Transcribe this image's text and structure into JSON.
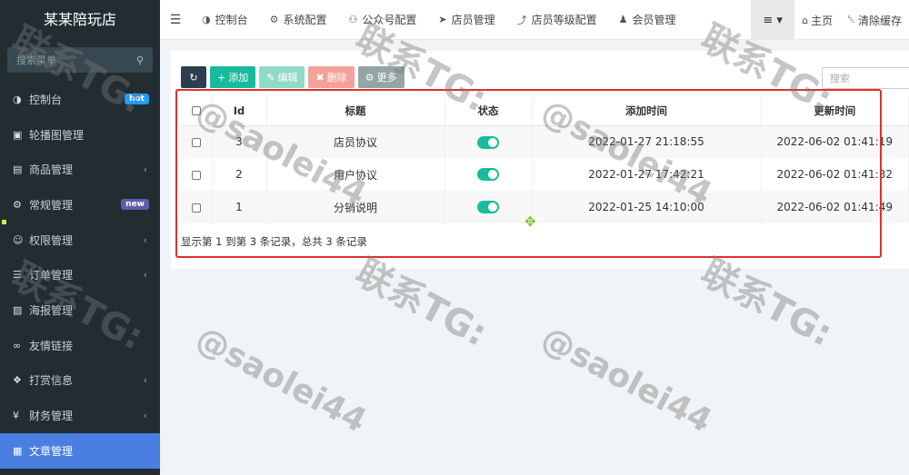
{
  "app": {
    "title": "某某陪玩店"
  },
  "sidebar": {
    "search_placeholder": "搜索菜单",
    "items": [
      {
        "label": "控制台",
        "icon": "dashboard-icon",
        "glyph": "◑",
        "badge": "hot"
      },
      {
        "label": "轮播图管理",
        "icon": "image-icon",
        "glyph": "▣"
      },
      {
        "label": "商品管理",
        "icon": "book-icon",
        "glyph": "▤",
        "arrow": "‹"
      },
      {
        "label": "常规管理",
        "icon": "cogs-icon",
        "glyph": "⚙",
        "badge": "new"
      },
      {
        "label": "权限管理",
        "icon": "users-icon",
        "glyph": "☺",
        "arrow": "‹"
      },
      {
        "label": "订单管理",
        "icon": "list-icon",
        "glyph": "☰",
        "arrow": "‹"
      },
      {
        "label": "海报管理",
        "icon": "picture-icon",
        "glyph": "▨"
      },
      {
        "label": "友情链接",
        "icon": "link-icon",
        "glyph": "∞"
      },
      {
        "label": "打赏信息",
        "icon": "gift-icon",
        "glyph": "❖",
        "arrow": "‹"
      },
      {
        "label": "财务管理",
        "icon": "yen-icon",
        "glyph": "¥",
        "arrow": "‹"
      },
      {
        "label": "文章管理",
        "icon": "newspaper-icon",
        "glyph": "▦",
        "active": true
      }
    ]
  },
  "navbar": {
    "tabs": [
      {
        "label": "控制台",
        "icon": "dashboard-icon",
        "glyph": "◑"
      },
      {
        "label": "系统配置",
        "icon": "gear-icon",
        "glyph": "⚙"
      },
      {
        "label": "公众号配置",
        "icon": "wechat-icon",
        "glyph": "⚇"
      },
      {
        "label": "店员管理",
        "icon": "send-icon",
        "glyph": "➤"
      },
      {
        "label": "店员等级配置",
        "icon": "level-icon",
        "glyph": "⤴"
      },
      {
        "label": "会员管理",
        "icon": "user-icon",
        "glyph": "♟"
      }
    ],
    "menu_glyph": "≡ ▾",
    "home": {
      "label": "主页",
      "glyph": "⌂"
    },
    "clear_cache": {
      "label": "清除缓存",
      "glyph": "␡"
    }
  },
  "toolbar": {
    "refresh_glyph": "↻",
    "add": "添加",
    "add_glyph": "+",
    "edit": "编辑",
    "edit_glyph": "✎",
    "delete": "删除",
    "delete_glyph": "✖",
    "more": "更多",
    "more_glyph": "⚙",
    "search_placeholder": "搜索"
  },
  "table": {
    "headers": [
      "Id",
      "标题",
      "状态",
      "添加时间",
      "更新时间"
    ],
    "rows": [
      {
        "id": "3",
        "title": "店员协议",
        "status": true,
        "created": "2022-01-27 21:18:55",
        "updated": "2022-06-02 01:41:19"
      },
      {
        "id": "2",
        "title": "用户协议",
        "status": true,
        "created": "2022-01-27 17:42:21",
        "updated": "2022-06-02 01:41:32"
      },
      {
        "id": "1",
        "title": "分销说明",
        "status": true,
        "created": "2022-01-25 14:10:00",
        "updated": "2022-06-02 01:41:49"
      }
    ],
    "pagination_info": "显示第 1 到第 3 条记录，总共 3 条记录"
  },
  "watermark": {
    "contact": "联系TG:",
    "handle": "@saolei44"
  },
  "colors": {
    "accent": "#18bc9c",
    "sidebar": "#222d32",
    "active": "#4a7ee0",
    "highlight_frame": "#e0302b"
  }
}
